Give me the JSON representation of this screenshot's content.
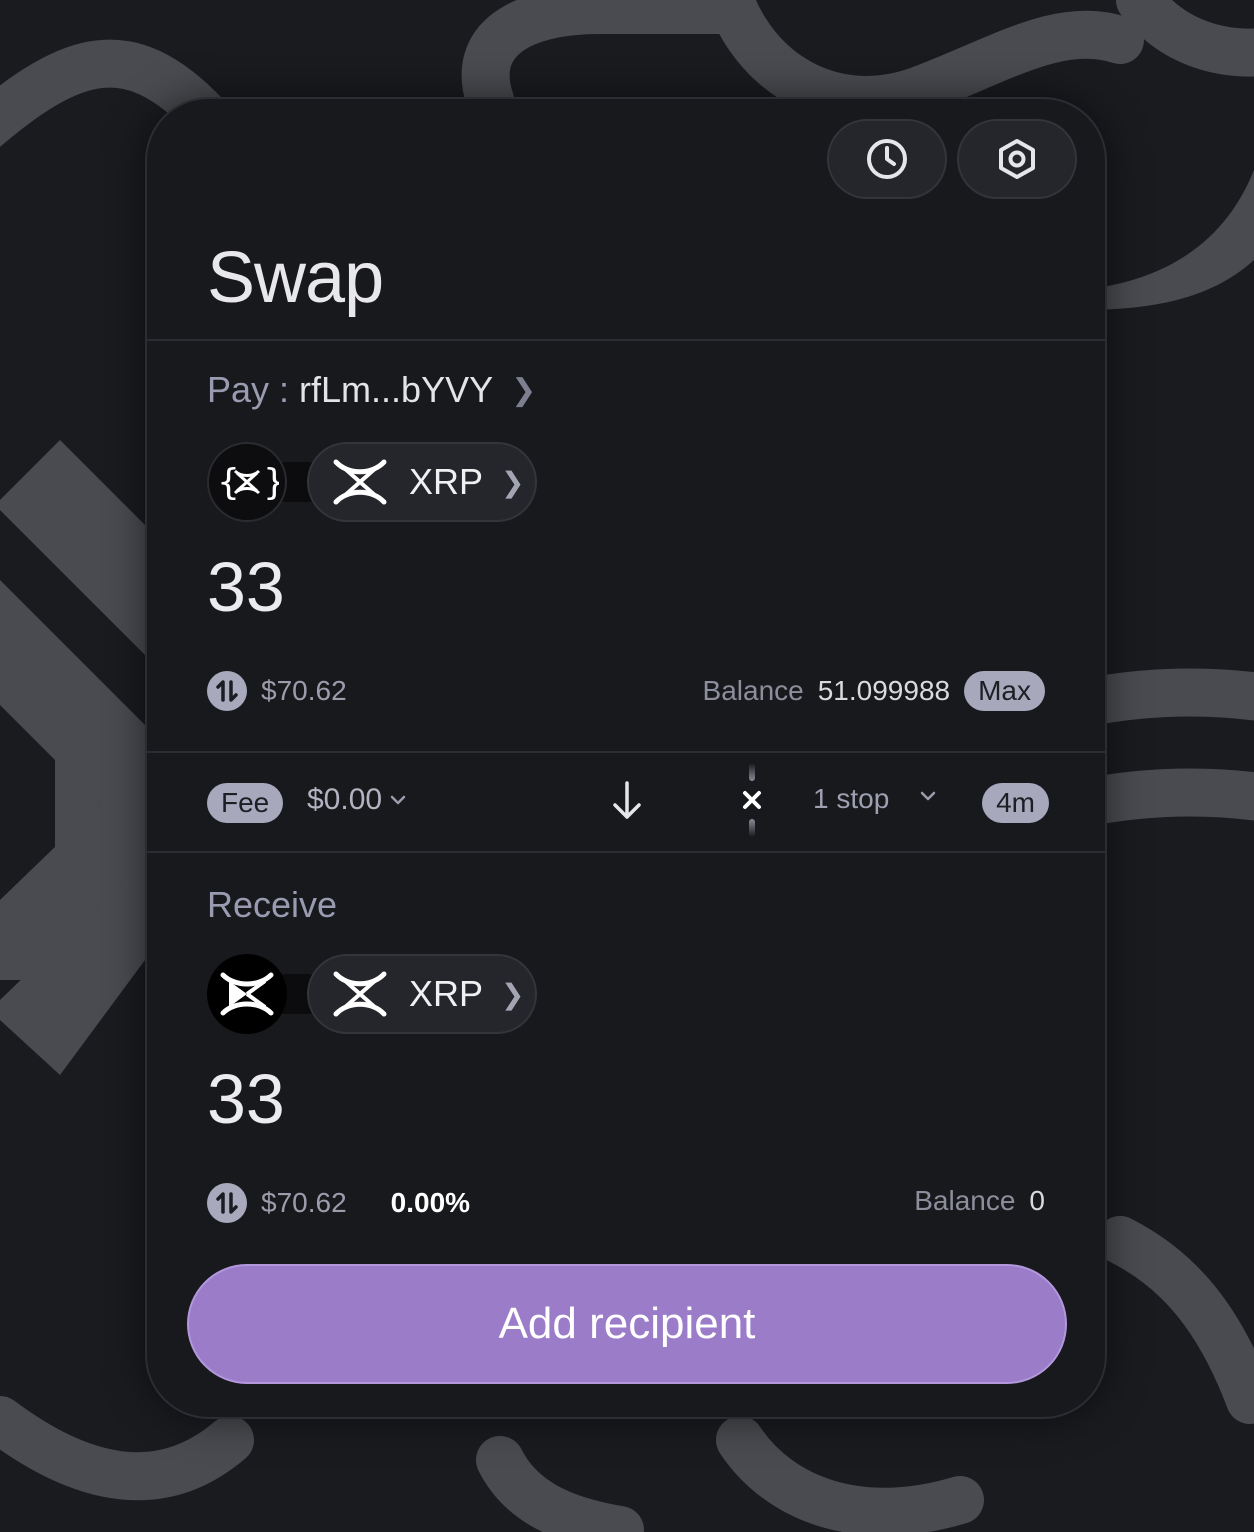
{
  "header": {
    "title": "Swap",
    "history_icon": "clock-icon",
    "settings_icon": "hexagon-gear-icon"
  },
  "pay": {
    "label": "Pay :",
    "address": "rfLm...bYVY",
    "wallet_icon": "xaman-wallet-icon",
    "token_icon": "xrp-icon",
    "token": "XRP",
    "amount": "33",
    "usd": "$70.62",
    "balance_label": "Balance",
    "balance": "51.099988",
    "max_label": "Max"
  },
  "route": {
    "fee_label": "Fee",
    "fee_value": "$0.00",
    "stops": "1 stop",
    "time": "4m"
  },
  "receive": {
    "label": "Receive",
    "wallet_icon": "xaman-x-icon",
    "token_icon": "xrp-icon",
    "token": "XRP",
    "amount": "33",
    "usd": "$70.62",
    "price_impact": "0.00%",
    "balance_label": "Balance",
    "balance": "0"
  },
  "cta": {
    "label": "Add recipient"
  },
  "colors": {
    "accent": "#9a7cc9",
    "card": "#18191d",
    "chip": "#a8a8bd"
  }
}
